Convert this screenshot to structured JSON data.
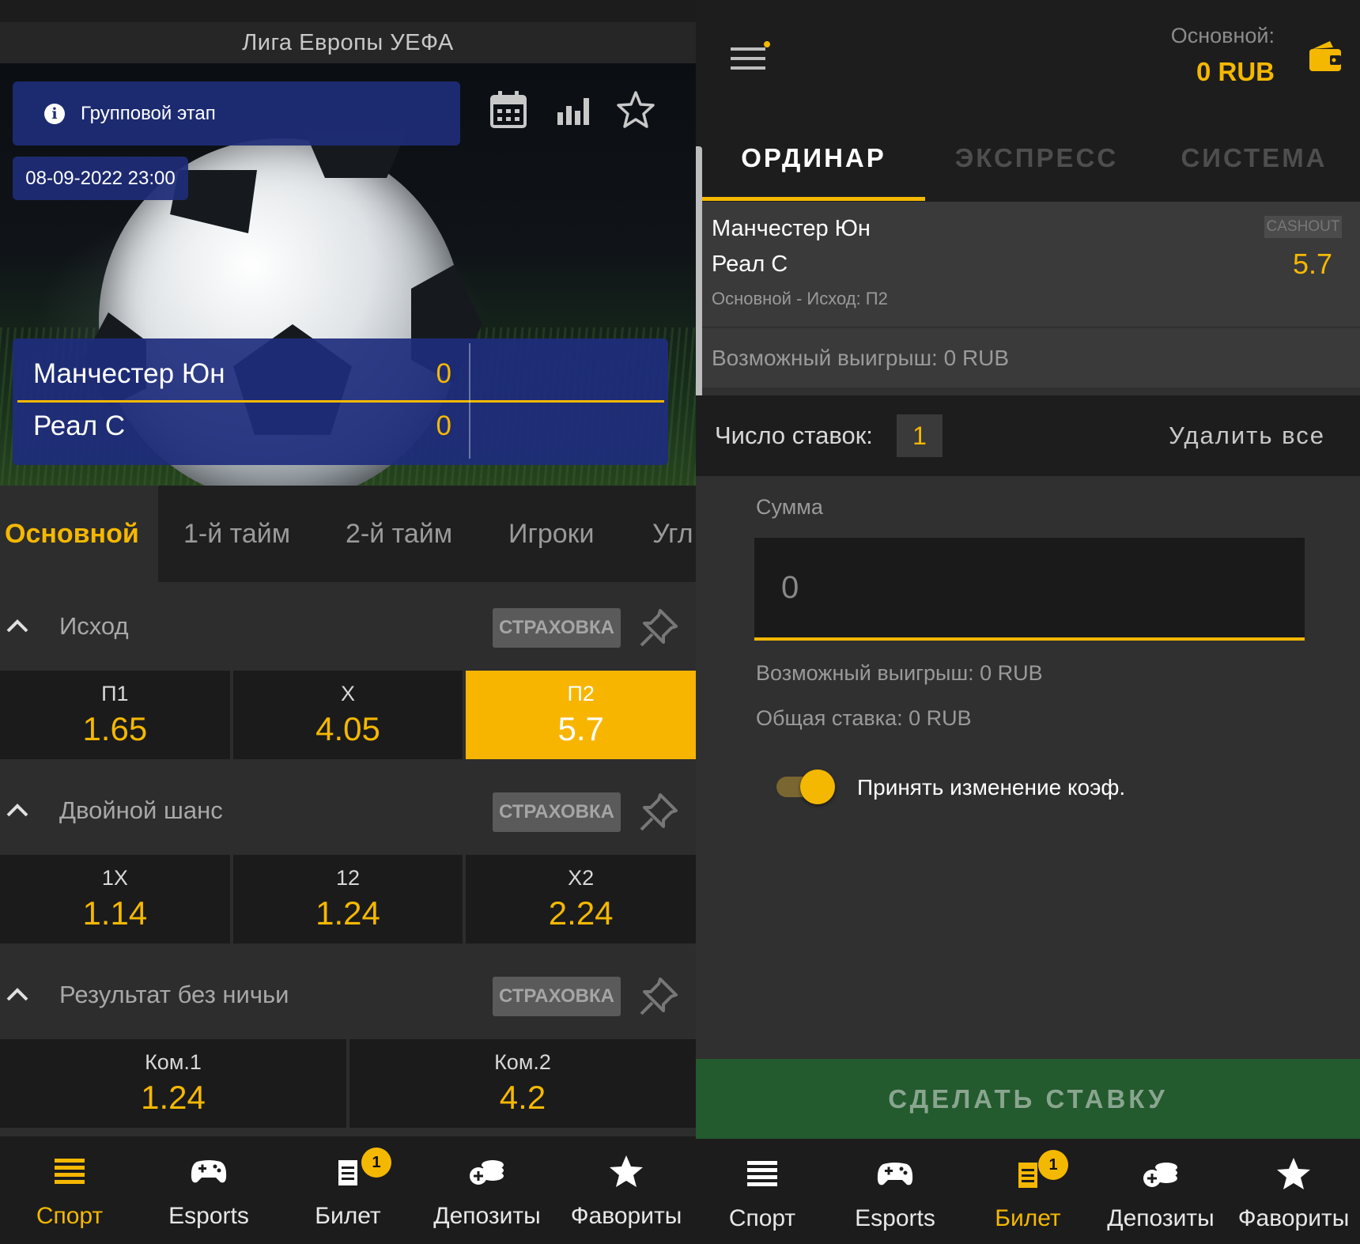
{
  "left": {
    "league": "Лига Европы УЕФА",
    "stage": "Групповой этап",
    "date": "08-09-2022  23:00",
    "teams": [
      {
        "name": "Манчестер Юн",
        "score": "0"
      },
      {
        "name": "Реал С",
        "score": "0"
      }
    ],
    "tabs": [
      "Основной",
      "1-й тайм",
      "2-й тайм",
      "Игроки",
      "Угл"
    ],
    "insurance_label": "СТРАХОВКА",
    "markets": [
      {
        "title": "Исход",
        "odds": [
          {
            "label": "П1",
            "value": "1.65"
          },
          {
            "label": "X",
            "value": "4.05"
          },
          {
            "label": "П2",
            "value": "5.7",
            "selected": true
          }
        ]
      },
      {
        "title": "Двойной шанс",
        "odds": [
          {
            "label": "1X",
            "value": "1.14"
          },
          {
            "label": "12",
            "value": "1.24"
          },
          {
            "label": "X2",
            "value": "2.24"
          }
        ]
      },
      {
        "title": "Результат без ничьи",
        "odds": [
          {
            "label": "Ком.1",
            "value": "1.24"
          },
          {
            "label": "Ком.2",
            "value": "4.2"
          }
        ]
      }
    ],
    "nav": [
      {
        "label": "Спорт",
        "icon": "list-icon",
        "active": true
      },
      {
        "label": "Esports",
        "icon": "gamepad-icon"
      },
      {
        "label": "Билет",
        "icon": "ticket-icon",
        "badge": "1"
      },
      {
        "label": "Депозиты",
        "icon": "coins-icon"
      },
      {
        "label": "Фавориты",
        "icon": "star-icon"
      }
    ]
  },
  "right": {
    "balance_label": "Основной:",
    "balance_value": "0 RUB",
    "tabs": [
      "ОРДИНАР",
      "ЭКСПРЕСС",
      "СИСТЕМА"
    ],
    "bet": {
      "team1": "Манчестер Юн",
      "team2": "Реал С",
      "market": "Основной - Исход: П2",
      "cashout": "CASHOUT",
      "odds": "5.7",
      "possible_win": "Возможный выигрыш: 0 RUB"
    },
    "count_label": "Число ставок:",
    "count_value": "1",
    "delete_all": "Удалить все",
    "sum_label": "Сумма",
    "sum_placeholder": "0",
    "possible_win2": "Возможный выигрыш: 0 RUB",
    "total_stake": "Общая ставка: 0 RUB",
    "accept_change": "Принять изменение коэф.",
    "place_bet": "СДЕЛАТЬ СТАВКУ",
    "nav": [
      {
        "label": "Спорт",
        "icon": "list-icon"
      },
      {
        "label": "Esports",
        "icon": "gamepad-icon"
      },
      {
        "label": "Билет",
        "icon": "ticket-icon",
        "badge": "1",
        "active": true
      },
      {
        "label": "Депозиты",
        "icon": "coins-icon"
      },
      {
        "label": "Фавориты",
        "icon": "star-icon"
      }
    ]
  },
  "colors": {
    "accent": "#f5b800",
    "team_box": "#1e2d7d",
    "bet_button": "#235a2e"
  }
}
